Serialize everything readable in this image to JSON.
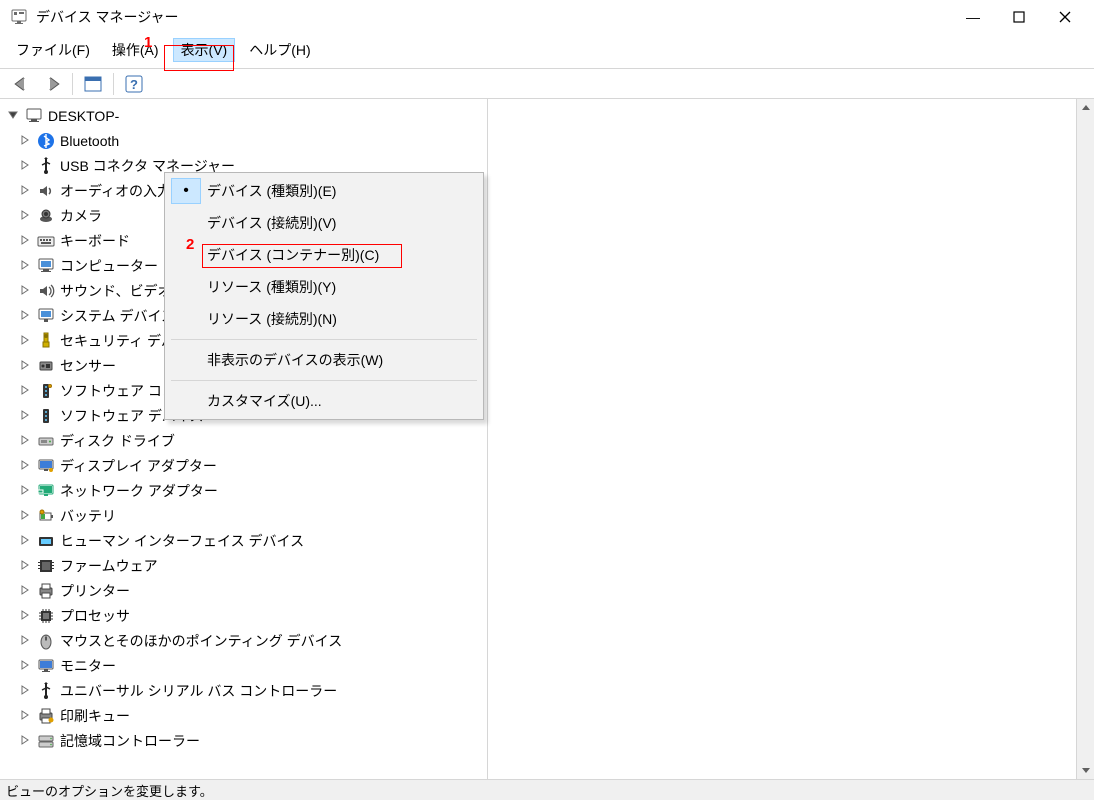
{
  "window": {
    "title": "デバイス マネージャー"
  },
  "winbtns": {
    "min": "—",
    "max": "☐",
    "close": "✕"
  },
  "menubar": {
    "file": "ファイル(F)",
    "action": "操作(A)",
    "view": "表示(V)",
    "help": "ヘルプ(H)"
  },
  "view_menu": {
    "devices_type": "デバイス (種類別)(E)",
    "devices_conn": "デバイス (接続別)(V)",
    "devices_container": "デバイス (コンテナー別)(C)",
    "res_type": "リソース (種類別)(Y)",
    "res_conn": "リソース (接続別)(N)",
    "show_hidden": "非表示のデバイスの表示(W)",
    "customize": "カスタマイズ(U)..."
  },
  "tree": {
    "root": "DESKTOP-",
    "items": [
      {
        "label": "Bluetooth",
        "icon": "bluetooth"
      },
      {
        "label": "USB コネクタ マネージャー",
        "icon": "usb"
      },
      {
        "label": "オーディオの入力および出力",
        "icon": "audio"
      },
      {
        "label": "カメラ",
        "icon": "camera"
      },
      {
        "label": "キーボード",
        "icon": "keyboard"
      },
      {
        "label": "コンピューター",
        "icon": "computer"
      },
      {
        "label": "サウンド、ビデオ、およびゲーム コントローラー",
        "icon": "sound"
      },
      {
        "label": "システム デバイス",
        "icon": "system"
      },
      {
        "label": "セキュリティ デバイス",
        "icon": "security"
      },
      {
        "label": "センサー",
        "icon": "sensor"
      },
      {
        "label": "ソフトウェア コンポーネント",
        "icon": "component"
      },
      {
        "label": "ソフトウェア デバイス",
        "icon": "swdevice"
      },
      {
        "label": "ディスク ドライブ",
        "icon": "disk"
      },
      {
        "label": "ディスプレイ アダプター",
        "icon": "display"
      },
      {
        "label": "ネットワーク アダプター",
        "icon": "network"
      },
      {
        "label": "バッテリ",
        "icon": "battery"
      },
      {
        "label": "ヒューマン インターフェイス デバイス",
        "icon": "hid"
      },
      {
        "label": "ファームウェア",
        "icon": "firmware"
      },
      {
        "label": "プリンター",
        "icon": "printer"
      },
      {
        "label": "プロセッサ",
        "icon": "cpu"
      },
      {
        "label": "マウスとそのほかのポインティング デバイス",
        "icon": "mouse"
      },
      {
        "label": "モニター",
        "icon": "monitor"
      },
      {
        "label": "ユニバーサル シリアル バス コントローラー",
        "icon": "usbctrl"
      },
      {
        "label": "印刷キュー",
        "icon": "printq"
      },
      {
        "label": "記憶域コントローラー",
        "icon": "storage"
      }
    ]
  },
  "statusbar": {
    "text": "ビューのオプションを変更します。"
  },
  "annotations": {
    "one": "1",
    "two": "2"
  }
}
